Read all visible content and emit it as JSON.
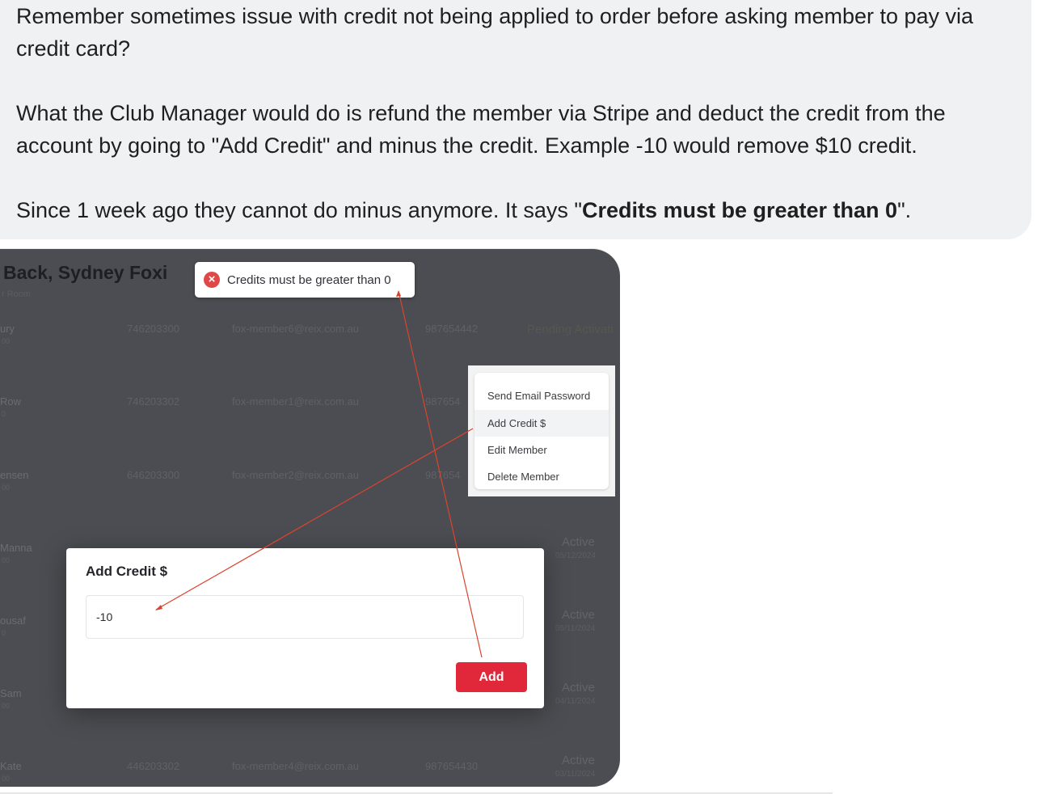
{
  "message": {
    "p1": "Remember sometimes issue with credit not being applied to order before asking member to pay via credit card?",
    "p2": "What the Club Manager would do is refund the member via Stripe and deduct the credit from the account by going to \"Add Credit\" and minus the credit. Example -10 would remove $10 credit.",
    "p3_before": "Since 1 week ago they cannot do minus anymore. It says \"",
    "p3_bold": "Credits must be greater than 0",
    "p3_after": "\"."
  },
  "screenshot": {
    "page_title": "Back, Sydney Foxi",
    "subtitle": "r Room",
    "toast": {
      "icon": "error-icon",
      "text": "Credits must be greater than 0"
    },
    "rows": [
      {
        "name": "ury",
        "sub": "00",
        "phone": "746203300",
        "email": "fox-member6@reix.com.au",
        "mobile": "987654442",
        "status": "Pending Activati",
        "date": ""
      },
      {
        "name": "Row",
        "sub": "0",
        "phone": "746203302",
        "email": "fox-member1@reix.com.au",
        "mobile": "987654",
        "status": "",
        "date": ""
      },
      {
        "name": "ensen",
        "sub": "00",
        "phone": "646203300",
        "email": "fox-member2@reix.com.au",
        "mobile": "987654",
        "status": "",
        "date": ""
      },
      {
        "name": "Manna",
        "sub": "00",
        "phone": "",
        "email": "",
        "mobile": "",
        "status": "Active",
        "date": "05/12/2024"
      },
      {
        "name": "ousaf",
        "sub": "0",
        "phone": "",
        "email": "",
        "mobile": "",
        "status": "Active",
        "date": "05/11/2024"
      },
      {
        "name": "Sam",
        "sub": "00",
        "phone": "",
        "email": "",
        "mobile": "",
        "status": "Active",
        "date": "04/11/2024"
      },
      {
        "name": "Kate",
        "sub": "00",
        "phone": "446203302",
        "email": "fox-member4@reix.com.au",
        "mobile": "987654430",
        "status": "Active",
        "date": "03/11/2024"
      }
    ],
    "context_menu": [
      {
        "label": "Send Email Password"
      },
      {
        "label": "Add Credit $"
      },
      {
        "label": "Edit Member"
      },
      {
        "label": "Delete Member"
      }
    ],
    "modal": {
      "title": "Add Credit $",
      "input_value": "-10",
      "button_label": "Add"
    },
    "colors": {
      "annotation": "#d9442e",
      "add_button": "#e0283a",
      "overlay": "#4b4d52"
    }
  }
}
